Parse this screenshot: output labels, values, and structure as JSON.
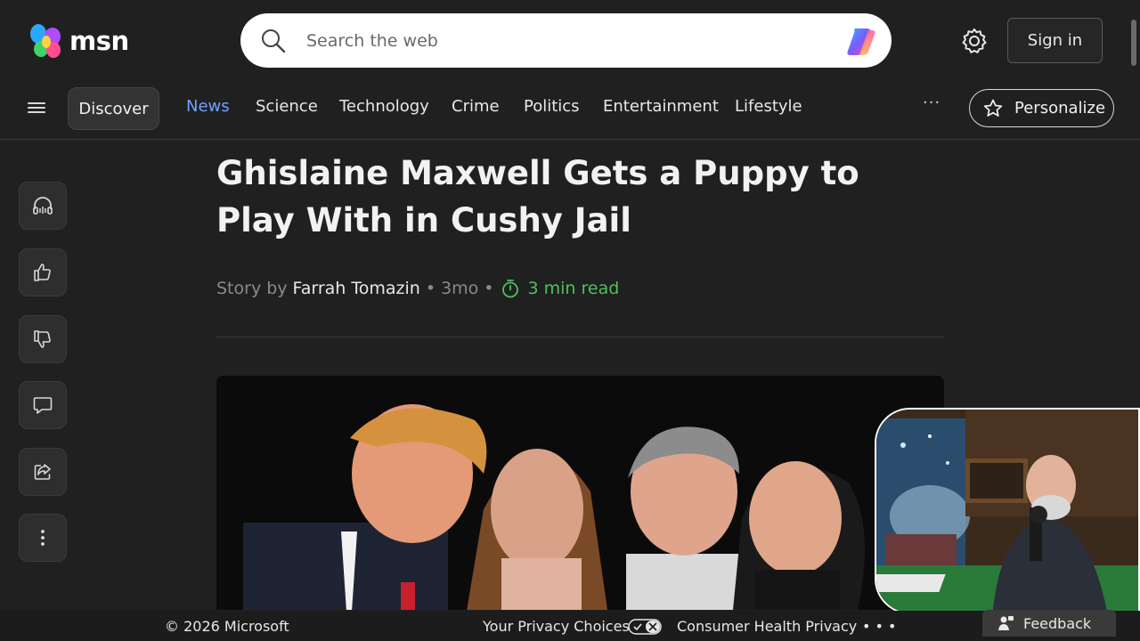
{
  "header": {
    "logo_text": "msn",
    "search_placeholder": "Search the web",
    "signin_label": "Sign in"
  },
  "nav": {
    "discover_label": "Discover",
    "links": [
      "News",
      "Science",
      "Technology",
      "Crime",
      "Politics",
      "Entertainment",
      "Lifestyle"
    ],
    "active": "News",
    "more_label": "···",
    "personalize_label": "Personalize"
  },
  "rail": {
    "icons": [
      "headphones-icon",
      "thumbs-up-icon",
      "thumbs-down-icon",
      "comment-icon",
      "share-icon",
      "more-vertical-icon"
    ]
  },
  "article": {
    "title": "Ghislaine Maxwell Gets a Puppy to Play With in Cushy Jail",
    "story_by_label": "Story by",
    "author": "Farrah Tomazin",
    "age": "3mo",
    "read_time": "3 min read"
  },
  "footer": {
    "copyright": "© 2026 Microsoft",
    "privacy_choices": "Your Privacy Choices",
    "health_privacy": "Consumer Health Privacy",
    "more": "• • •",
    "feedback": "Feedback"
  },
  "colors": {
    "background": "#202020",
    "accent_active": "#6fa3ff",
    "read_time": "#4cc25a"
  }
}
